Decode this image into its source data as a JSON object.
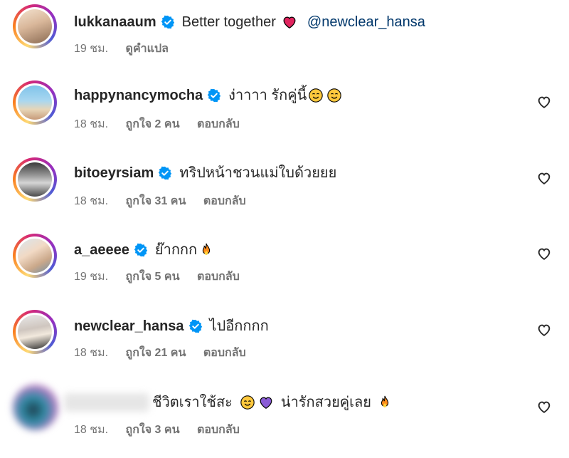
{
  "comments": [
    {
      "username": "lukkanaaum",
      "text": "Better together",
      "mention": "@newclear_hansa",
      "time": "19 ชม.",
      "action": "ดูคำแปล"
    },
    {
      "username": "happynancymocha",
      "text": "ง่าาาา รักคู่นี้",
      "time": "18 ชม.",
      "likes": "ถูกใจ 2 คน",
      "reply": "ตอบกลับ"
    },
    {
      "username": "bitoeyrsiam",
      "text": "ทริปหน้าชวนแม่ใบด้วยยย",
      "time": "18 ชม.",
      "likes": "ถูกใจ 31 คน",
      "reply": "ตอบกลับ"
    },
    {
      "username": "a_aeeee",
      "text": "ย๊ากกก",
      "time": "19 ชม.",
      "likes": "ถูกใจ 5 คน",
      "reply": "ตอบกลับ"
    },
    {
      "username": "newclear_hansa",
      "text": "ไปอีกกกก",
      "time": "18 ชม.",
      "likes": "ถูกใจ 21 คน",
      "reply": "ตอบกลับ"
    },
    {
      "text_a": "ชีวิตเราใช้สะ",
      "text_b": "น่ารักสวยคู่เลย",
      "time": "18 ชม.",
      "likes": "ถูกใจ 3 คน",
      "reply": "ตอบกลับ"
    }
  ],
  "colors": {
    "verified": "#0095f6",
    "mention": "#00376b",
    "meta": "#737373"
  },
  "icons": [
    "verified-badge-icon",
    "heart-icon",
    "red-heart-emoji",
    "smiling-emoji",
    "purple-heart-emoji",
    "fire-emoji"
  ]
}
